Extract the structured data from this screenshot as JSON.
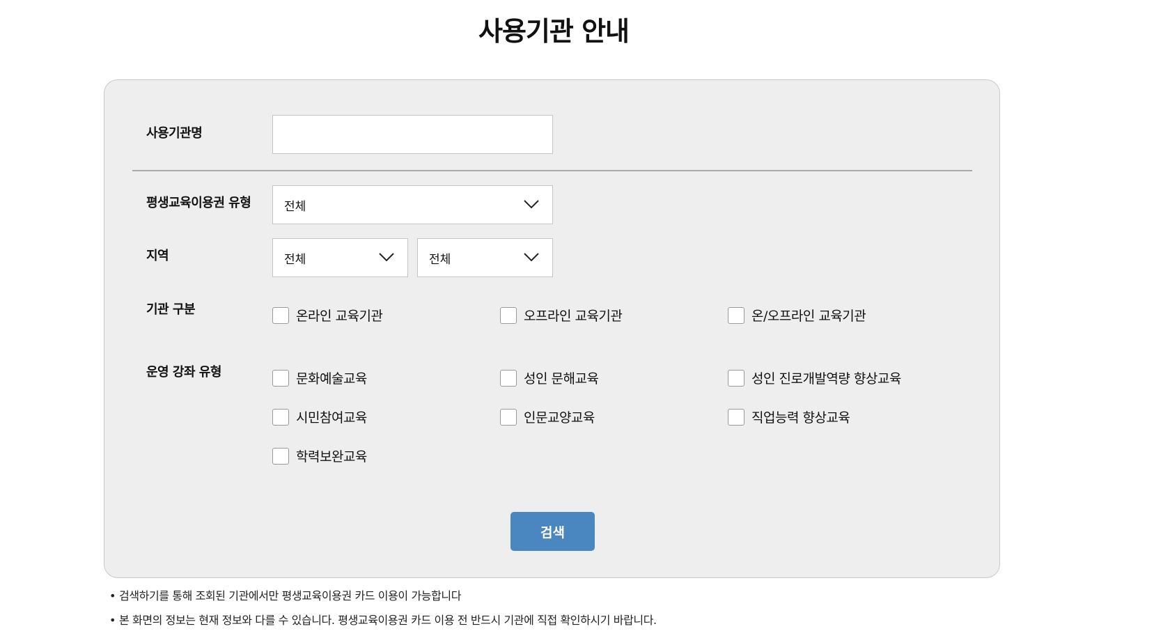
{
  "title": "사용기관 안내",
  "form": {
    "name_label": "사용기관명",
    "name_value": "",
    "voucher_type_label": "평생교육이용권 유형",
    "voucher_type_value": "전체",
    "region_label": "지역",
    "region_primary_value": "전체",
    "region_secondary_value": "전체",
    "org_type_label": "기관 구분",
    "org_types": [
      {
        "label": "온라인 교육기관",
        "checked": false
      },
      {
        "label": "오프라인 교육기관",
        "checked": false
      },
      {
        "label": "온/오프라인 교육기관",
        "checked": false
      }
    ],
    "course_type_label": "운영 강좌 유형",
    "course_types": [
      {
        "label": "문화예술교육",
        "checked": false
      },
      {
        "label": "성인 문해교육",
        "checked": false
      },
      {
        "label": "성인 진로개발역량 향상교육",
        "checked": false
      },
      {
        "label": "시민참여교육",
        "checked": false
      },
      {
        "label": "인문교양교육",
        "checked": false
      },
      {
        "label": "직업능력 향상교육",
        "checked": false
      },
      {
        "label": "학력보완교육",
        "checked": false
      }
    ],
    "search_button": "검색"
  },
  "notices": [
    "검색하기를 통해 조회된 기관에서만 평생교육이용권 카드 이용이 가능합니다",
    "본 화면의 정보는 현재 정보와 다를 수 있습니다. 평생교육이용권 카드 이용 전 반드시 기관에 직접 확인하시기 바랍니다."
  ],
  "colors": {
    "panel_bg": "#eeeeee",
    "button_bg": "#4a86bf",
    "button_text": "#ffffff"
  }
}
